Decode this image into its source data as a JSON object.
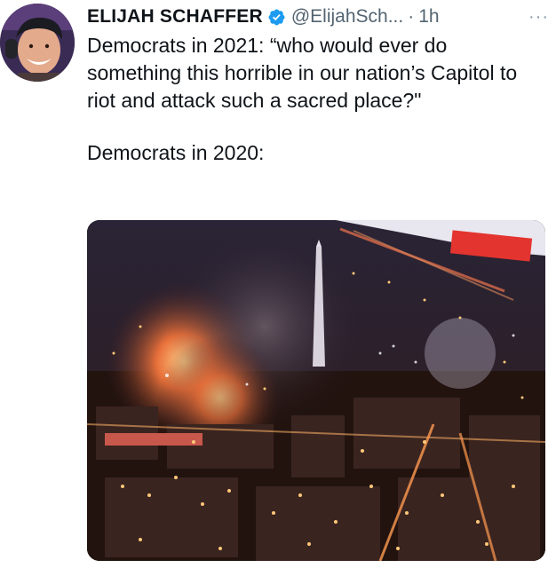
{
  "author": {
    "display_name": "ELIJAH SCHAFFER",
    "handle": "@ElijahSch...",
    "separator": "·",
    "time": "1h",
    "avatar_icon": "avatar-photo",
    "verified_icon": "verified-badge-icon",
    "verified_color": "#1d9bf0"
  },
  "menu": {
    "more_label": "···"
  },
  "tweet": {
    "line1": "Democrats in 2021: “who would ever do something this horrible in our nation’s Capitol to riot and attack such a sacred place?\"",
    "line2": "Democrats in 2020:"
  },
  "media": {
    "kind": "photo",
    "subject": "night-city-fires-washington-monument"
  }
}
